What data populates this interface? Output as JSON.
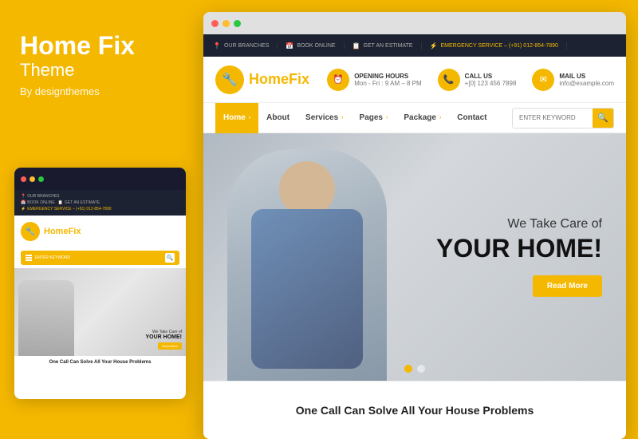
{
  "left": {
    "title": "Home Fix",
    "subtitle": "Theme",
    "by": "By designthemes",
    "dots": [
      "red",
      "yellow",
      "green"
    ]
  },
  "topbar": {
    "items": [
      {
        "icon": "📍",
        "label": "OUR BRANCHES"
      },
      {
        "icon": "📅",
        "label": "BOOK ONLINE"
      },
      {
        "icon": "📋",
        "label": "GET AN ESTIMATE"
      },
      {
        "icon": "⚡",
        "label": "EMERGENCY SERVICE – (+91) 012-854-7890",
        "highlight": true
      }
    ]
  },
  "header": {
    "logo_text_1": "Home",
    "logo_text_2": "Fix",
    "info_items": [
      {
        "icon": "⏰",
        "label": "OPENING HOURS",
        "value": "Mon - Fri : 9 AM – 8 PM"
      },
      {
        "icon": "📞",
        "label": "CALL US",
        "value": "+[0] 123 456 7898"
      },
      {
        "icon": "✉",
        "label": "MAIL US",
        "value": "info@example.com"
      }
    ]
  },
  "nav": {
    "items": [
      {
        "label": "Home",
        "active": true,
        "has_arrow": true
      },
      {
        "label": "About",
        "active": false,
        "has_arrow": false
      },
      {
        "label": "Services",
        "active": false,
        "has_arrow": true
      },
      {
        "label": "Pages",
        "active": false,
        "has_arrow": true
      },
      {
        "label": "Package",
        "active": false,
        "has_arrow": true
      },
      {
        "label": "Contact",
        "active": false,
        "has_arrow": false
      }
    ],
    "search_placeholder": "ENTER KEYWORD"
  },
  "hero": {
    "tagline": "We Take Care of",
    "title": "YOUR HOME!",
    "button_label": "Read More",
    "dots": [
      true,
      false
    ]
  },
  "bottom_teaser": {
    "text": "One Call Can Solve All Your House Problems"
  },
  "mini": {
    "logo_text_1": "Home",
    "logo_text_2": "Fix",
    "search_placeholder": "ENTER KEYWORD",
    "hero_tagline": "We Take Care of",
    "hero_title": "YOUR HOME!",
    "hero_btn": "Read More",
    "bottom_text": "One Call Can Solve All Your House Problems"
  }
}
